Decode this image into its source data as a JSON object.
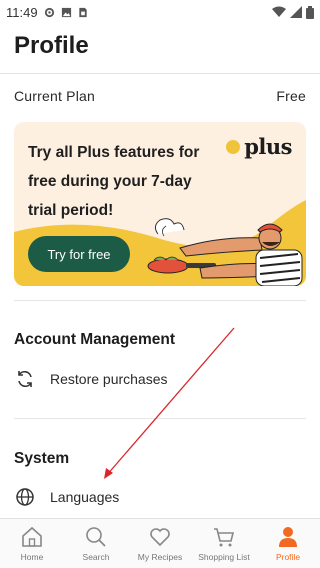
{
  "status_bar": {
    "time": "11:49"
  },
  "header": {
    "title": "Profile"
  },
  "plan": {
    "label": "Current Plan",
    "value": "Free"
  },
  "promo": {
    "text": "Try all Plus features for free during your 7-day trial period!",
    "logo_word": "plus",
    "button_label": "Try for free",
    "accent_color": "#f3c53a",
    "button_color": "#1c5c47"
  },
  "account": {
    "title": "Account Management",
    "items": [
      {
        "label": "Restore purchases",
        "icon": "refresh-icon"
      }
    ]
  },
  "system": {
    "title": "System",
    "items": [
      {
        "label": "Languages",
        "icon": "globe-icon"
      }
    ]
  },
  "tabs": [
    {
      "label": "Home",
      "icon": "home-icon",
      "active": false
    },
    {
      "label": "Search",
      "icon": "search-icon",
      "active": false
    },
    {
      "label": "My Recipes",
      "icon": "heart-icon",
      "active": false
    },
    {
      "label": "Shopping List",
      "icon": "cart-icon",
      "active": false
    },
    {
      "label": "Profile",
      "icon": "person-icon",
      "active": true
    }
  ],
  "colors": {
    "active_tab": "#f26a21",
    "annotation_arrow": "#d9262c"
  }
}
